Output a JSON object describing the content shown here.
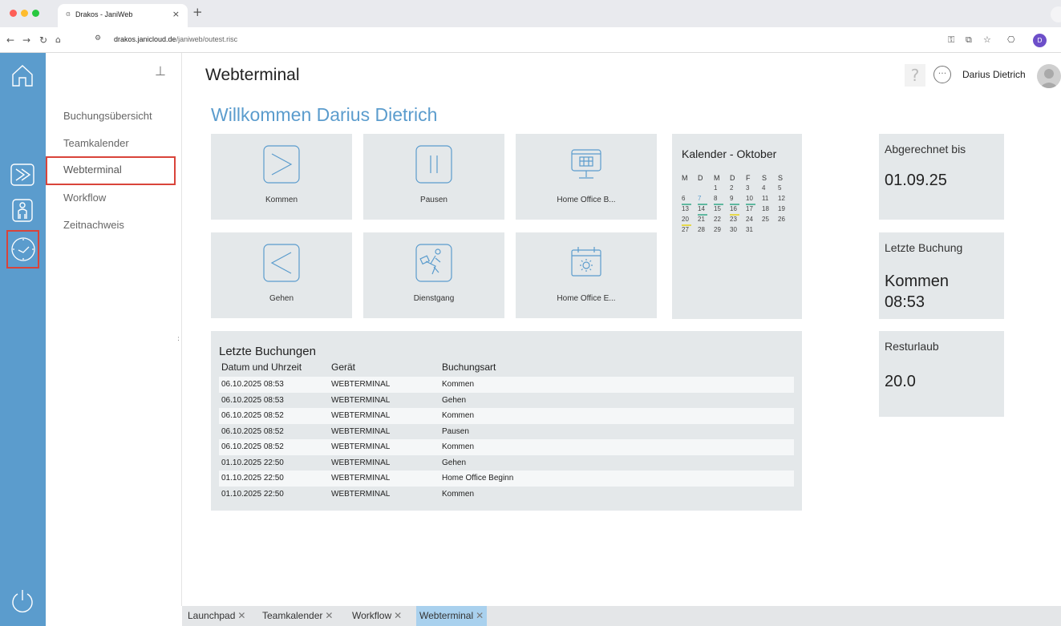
{
  "browser": {
    "tab_title": "Drakos - JaniWeb",
    "tab_close": "×",
    "new_tab": "+",
    "url_host": "drakos.janicloud.de",
    "url_path": "/janiweb/outest.risc",
    "profile_initial": "D",
    "icons": [
      "back-icon",
      "forward-icon",
      "reload-icon",
      "home-icon",
      "site-settings-icon",
      "key-icon",
      "cast-icon",
      "star-icon",
      "extensions-icon"
    ]
  },
  "rail": {
    "icons": [
      "home-icon",
      "terminal-arrow-icon",
      "person-badge-icon",
      "clock-icon",
      "power-icon"
    ],
    "active": "clock-icon"
  },
  "sidebar": {
    "items": [
      {
        "label": "Buchungsübersicht"
      },
      {
        "label": "Teamkalender"
      },
      {
        "label": "Webterminal"
      },
      {
        "label": "Workflow"
      },
      {
        "label": "Zeitnachweis"
      }
    ],
    "active_index": 2,
    "dots": ":"
  },
  "header": {
    "title": "Webterminal",
    "help_symbol": "?",
    "chat_symbol": "···",
    "user_name": "Darius Dietrich"
  },
  "welcome": "Willkommen Darius Dietrich",
  "tiles": [
    {
      "label": "Kommen",
      "icon": "arrow-in-icon"
    },
    {
      "label": "Pausen",
      "icon": "pause-icon"
    },
    {
      "label": "Home Office B...",
      "icon": "monitor-icon"
    },
    {
      "label": "Gehen",
      "icon": "arrow-out-icon"
    },
    {
      "label": "Dienstgang",
      "icon": "walker-icon"
    },
    {
      "label": "Home Office E...",
      "icon": "monitor-sun-icon"
    }
  ],
  "calendar": {
    "title": "Kalender - Oktober",
    "weekdays": [
      "M",
      "D",
      "M",
      "D",
      "F",
      "S",
      "S"
    ],
    "weeks": [
      [
        "",
        "",
        "1",
        "2",
        "3",
        "4",
        "5"
      ],
      [
        "6",
        "7",
        "8",
        "9",
        "10",
        "11",
        "12"
      ],
      [
        "13",
        "14",
        "15",
        "16",
        "17",
        "18",
        "19"
      ],
      [
        "20",
        "21",
        "22",
        "23",
        "24",
        "25",
        "26"
      ],
      [
        "27",
        "28",
        "29",
        "30",
        "31",
        "",
        ""
      ]
    ],
    "today": "7",
    "marked_green": [
      "6",
      "7",
      "8",
      "9",
      "10",
      "14"
    ],
    "marked_yellow": [
      "16",
      "20"
    ],
    "colors": {
      "green": "#5fb8a0",
      "yellow": "#e6d84a",
      "today": "#5b9ccd"
    }
  },
  "info_cards": [
    {
      "label": "Abgerechnet bis",
      "value": "01.09.25"
    },
    {
      "label": "Letzte Buchung",
      "value_line1": "Kommen",
      "value_line2": "08:53"
    },
    {
      "label": "Resturlaub",
      "value": "20.0"
    }
  ],
  "bookings": {
    "title": "Letzte Buchungen",
    "columns": [
      "Datum und Uhrzeit",
      "Gerät",
      "Buchungsart"
    ],
    "rows": [
      [
        "06.10.2025 08:53",
        "WEBTERMINAL",
        "Kommen"
      ],
      [
        "06.10.2025 08:53",
        "WEBTERMINAL",
        "Gehen"
      ],
      [
        "06.10.2025 08:52",
        "WEBTERMINAL",
        "Kommen"
      ],
      [
        "06.10.2025 08:52",
        "WEBTERMINAL",
        "Pausen"
      ],
      [
        "06.10.2025 08:52",
        "WEBTERMINAL",
        "Kommen"
      ],
      [
        "01.10.2025 22:50",
        "WEBTERMINAL",
        "Gehen"
      ],
      [
        "01.10.2025 22:50",
        "WEBTERMINAL",
        "Home Office Beginn"
      ],
      [
        "01.10.2025 22:50",
        "WEBTERMINAL",
        "Kommen"
      ]
    ]
  },
  "bottom_tabs": [
    {
      "label": "Launchpad"
    },
    {
      "label": "Teamkalender"
    },
    {
      "label": "Workflow"
    },
    {
      "label": "Webterminal"
    }
  ],
  "bottom_active_index": 3,
  "tab_close_symbol": "✕",
  "colors": {
    "accent": "#5b9ccd",
    "highlight": "#d9443a",
    "tile_bg": "#e4e8ea",
    "active_tab": "#a9d1ee"
  }
}
